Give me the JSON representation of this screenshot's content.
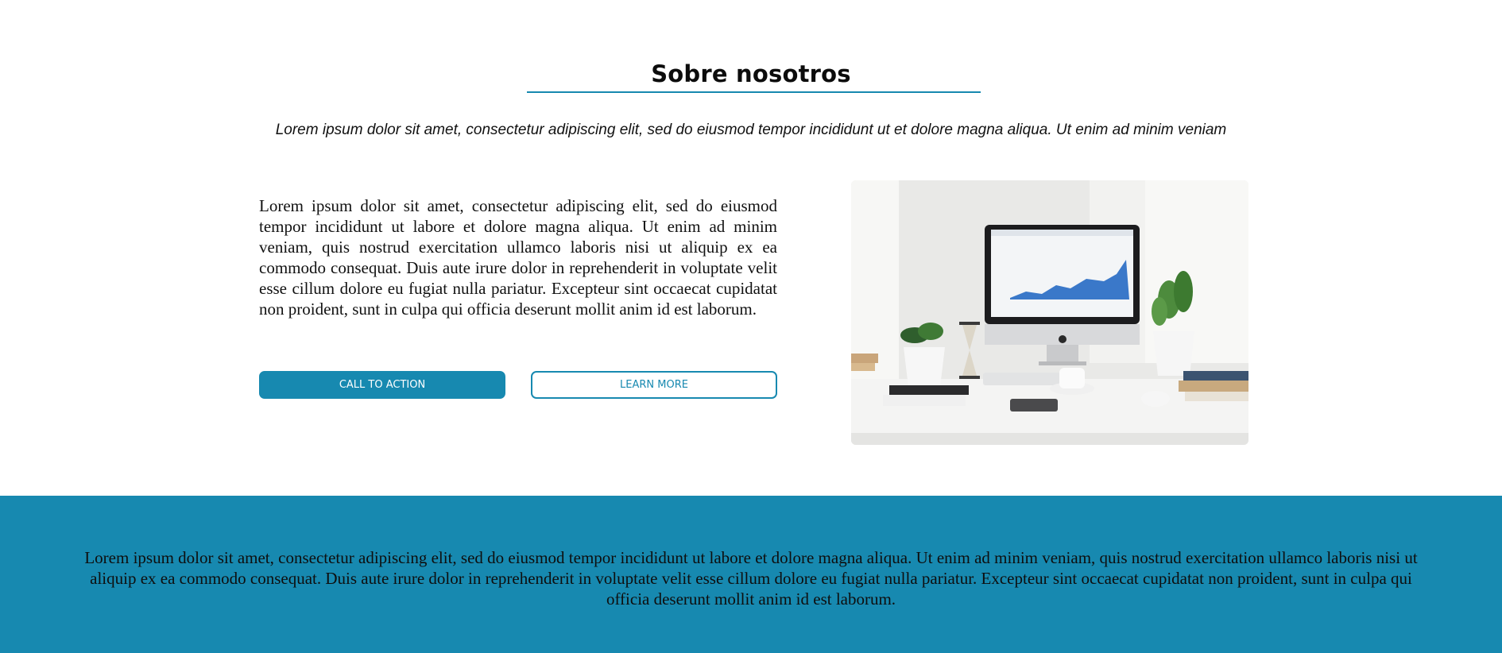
{
  "about": {
    "title": "Sobre nosotros",
    "subtitle": "Lorem ipsum dolor sit amet, consectetur adipiscing elit, sed do eiusmod tempor incididunt ut et dolore magna aliqua. Ut enim ad minim veniam",
    "body": "Lorem ipsum dolor sit amet, consectetur adipiscing elit, sed do eiusmod tempor incididunt ut labore et dolore magna aliqua. Ut enim ad minim veniam, quis nostrud exercitation ullamco laboris nisi ut aliquip ex ea commodo consequat. Duis aute irure dolor in reprehenderit in voluptate velit esse cillum dolore eu fugiat nulla pariatur. Excepteur sint occaecat cupidatat non proident, sunt in culpa qui officia deserunt mollit anim id est laborum.",
    "cta_label": "CALL TO ACTION",
    "learn_more_label": "LEARN MORE"
  },
  "footer": {
    "text": "Lorem ipsum dolor sit amet, consectetur adipiscing elit, sed do eiusmod tempor incididunt ut labore et dolore magna aliqua. Ut enim ad minim veniam, quis nostrud exercitation ullamco laboris nisi ut aliquip ex ea commodo consequat. Duis aute irure dolor in reprehenderit in voluptate velit esse cillum dolore eu fugiat nulla pariatur. Excepteur sint occaecat cupidatat non proident, sunt in culpa qui officia deserunt mollit anim id est laborum."
  },
  "colors": {
    "accent": "#1789b0",
    "background": "#ffffff"
  },
  "image": {
    "icon": "desk-computer-photo"
  }
}
